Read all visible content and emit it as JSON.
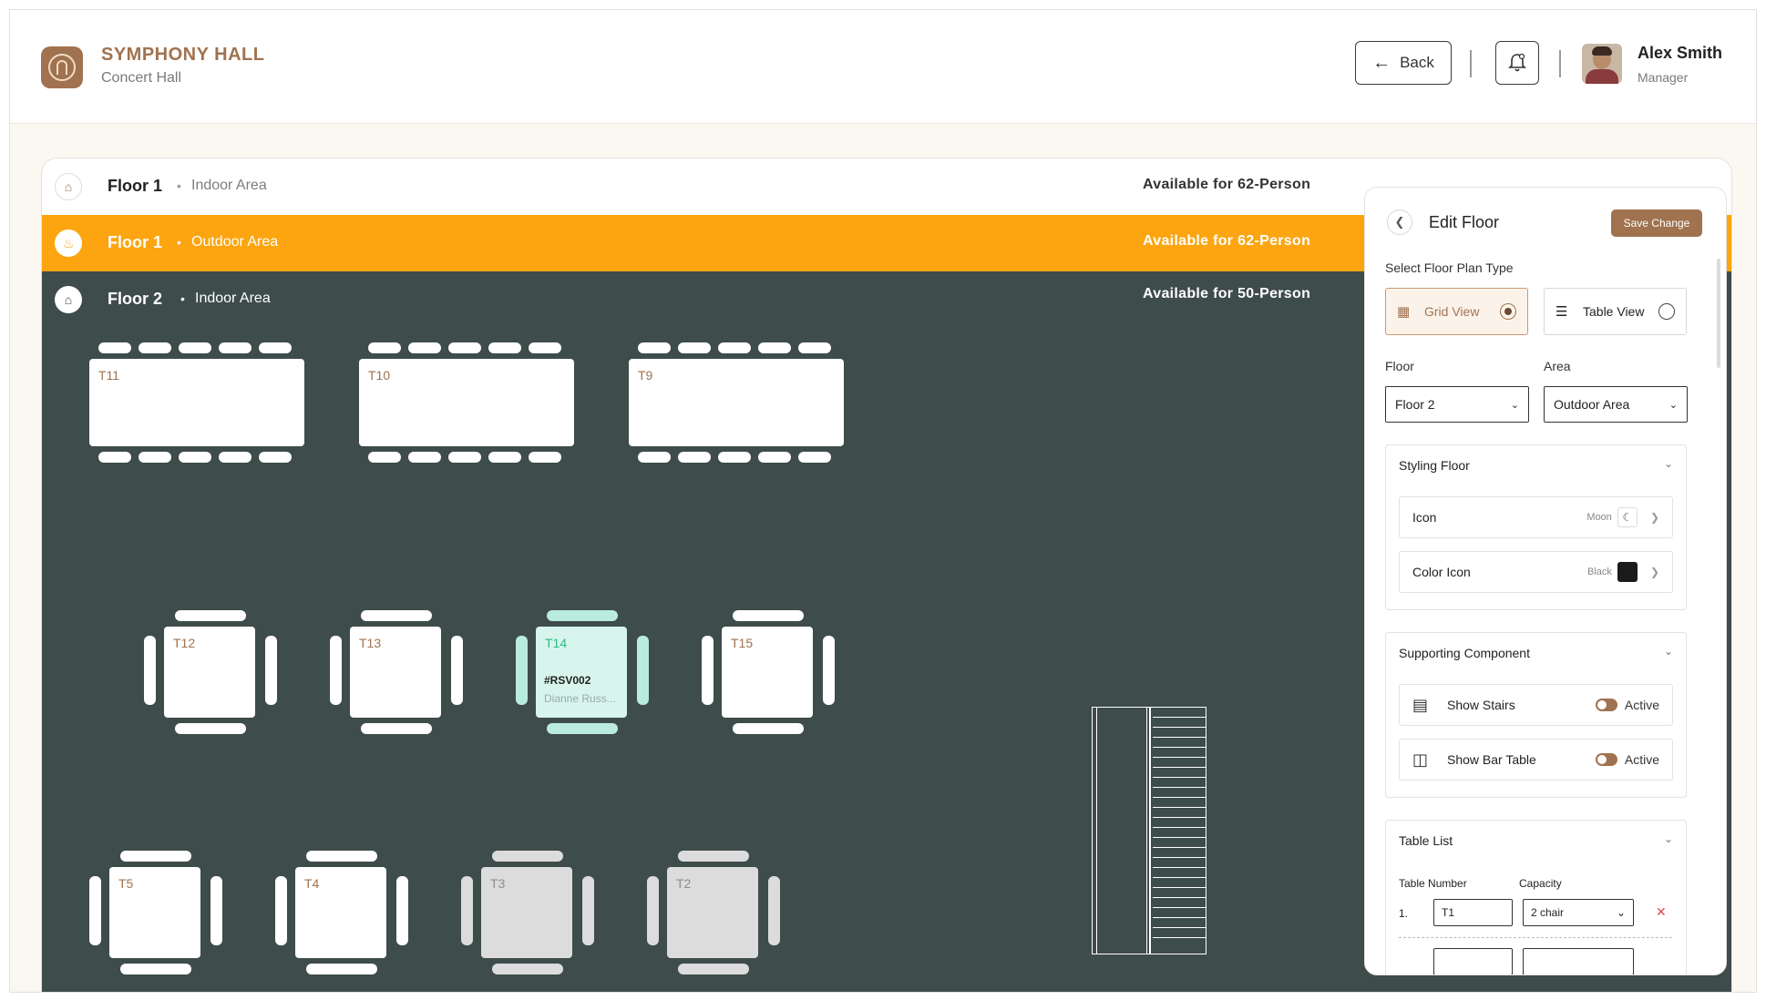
{
  "header": {
    "brand_title": "SYMPHONY HALL",
    "brand_subtitle": "Concert Hall",
    "back_label": "Back",
    "user_name": "Alex Smith",
    "user_role": "Manager"
  },
  "floors": [
    {
      "floor": "Floor 1",
      "area": "Indoor Area",
      "availability": "Available for 62-Person"
    },
    {
      "floor": "Floor 1",
      "area": "Outdoor Area",
      "availability": "Available for 62-Person"
    },
    {
      "floor": "Floor 2",
      "area": "Indoor Area",
      "availability": "Available for 50-Person"
    }
  ],
  "floor_plan": {
    "long_tables": [
      "T11",
      "T10",
      "T9"
    ],
    "square_tables_row1": [
      "T12",
      "T13",
      "T14",
      "T15"
    ],
    "square_tables_row2": [
      "T5",
      "T4",
      "T3",
      "T2"
    ],
    "reservation": {
      "table": "T14",
      "code": "#RSV002",
      "guest": "Dianne Russ..."
    }
  },
  "panel": {
    "title": "Edit Floor",
    "save_label": "Save Change",
    "plan_type_label": "Select Floor Plan Type",
    "grid_view_label": "Grid View",
    "table_view_label": "Table View",
    "floor_label": "Floor",
    "floor_value": "Floor 2",
    "area_label": "Area",
    "area_value": "Outdoor Area",
    "styling": {
      "title": "Styling Floor",
      "icon_label": "Icon",
      "icon_value": "Moon",
      "color_label": "Color Icon",
      "color_value": "Black",
      "color_hex": "#1b1b1b"
    },
    "supporting": {
      "title": "Supporting Component",
      "stairs_label": "Show Stairs",
      "stairs_status": "Active",
      "bar_label": "Show Bar Table",
      "bar_status": "Active"
    },
    "table_list": {
      "title": "Table List",
      "col_number": "Table Number",
      "col_capacity": "Capacity",
      "rows": [
        {
          "index": "1.",
          "number": "T1",
          "capacity": "2 chair"
        }
      ]
    }
  },
  "colors": {
    "accent": "#a0724f",
    "selected_row": "#fca510",
    "floor_bg": "#3e4c4b",
    "reserved": "#d7f5ec"
  }
}
